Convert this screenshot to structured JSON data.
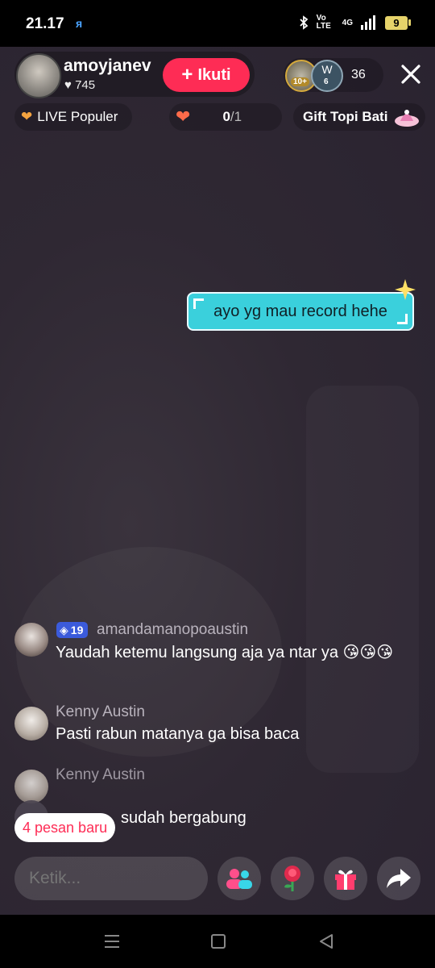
{
  "status_bar": {
    "time": "21.17",
    "volte": "Vo LTE",
    "network": "4G",
    "battery": "9"
  },
  "header": {
    "host_name": "amoyjanev",
    "host_likes": "745",
    "follow_label": "Ikuti",
    "viewer_badges": [
      "10+",
      "6"
    ],
    "viewer_initial": "W",
    "viewer_count": "36"
  },
  "chips": {
    "popular": "LIVE Populer",
    "goal_current": "0",
    "goal_total": "/1",
    "gift": "Gift Topi Bati"
  },
  "sticker_text": "ayo yg mau record hehe",
  "chat": [
    {
      "level": "19",
      "username": "amandamanopoaustin",
      "message": "Yaudah ketemu langsung aja ya ntar ya 😘😘😘"
    },
    {
      "username": "Kenny Austin",
      "message": "Pasti rabun matanya ga bisa baca"
    },
    {
      "username": "Kenny Austin",
      "message": ""
    }
  ],
  "join_message": "sudah bergabung",
  "new_messages_label": "4 pesan baru",
  "comment_input": {
    "placeholder": "Ketik..."
  },
  "accent_color": "#fe2c55"
}
